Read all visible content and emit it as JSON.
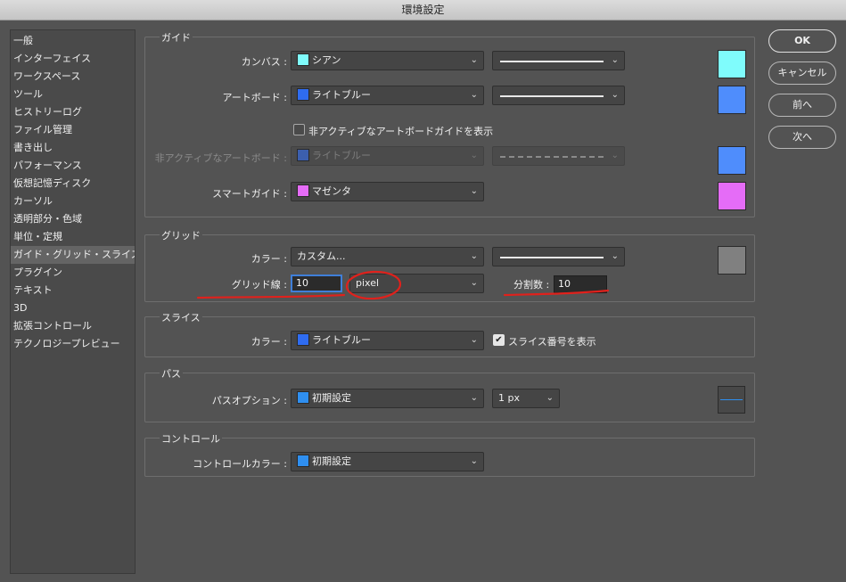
{
  "window": {
    "title": "環境設定"
  },
  "sidebar": {
    "items": [
      {
        "label": "一般"
      },
      {
        "label": "インターフェイス"
      },
      {
        "label": "ワークスペース"
      },
      {
        "label": "ツール"
      },
      {
        "label": "ヒストリーログ"
      },
      {
        "label": "ファイル管理"
      },
      {
        "label": "書き出し"
      },
      {
        "label": "パフォーマンス"
      },
      {
        "label": "仮想記憶ディスク"
      },
      {
        "label": "カーソル"
      },
      {
        "label": "透明部分・色域"
      },
      {
        "label": "単位・定規"
      },
      {
        "label": "ガイド・グリッド・スライス"
      },
      {
        "label": "プラグイン"
      },
      {
        "label": "テキスト"
      },
      {
        "label": "3D"
      },
      {
        "label": "拡張コントロール"
      },
      {
        "label": "テクノロジープレビュー"
      }
    ],
    "active_index": 12
  },
  "guides": {
    "title": "ガイド",
    "canvas": {
      "label": "カンバス :",
      "color": "シアン",
      "swatch": "#7ffcfc"
    },
    "artboard": {
      "label": "アートボード :",
      "color": "ライトブルー",
      "swatch": "#4f8dfc"
    },
    "inactive_checkbox_label": "非アクティブなアートボードガイドを表示",
    "inactive_artboard": {
      "label": "非アクティブなアートボード :",
      "color": "ライトブルー",
      "swatch": "#4f8dfc"
    },
    "smart": {
      "label": "スマートガイド :",
      "color": "マゼンタ",
      "swatch": "#e56cf7"
    }
  },
  "grid": {
    "title": "グリッド",
    "color_label": "カラー :",
    "color_value": "カスタム...",
    "swatch": "#808080",
    "gridline_label": "グリッド線 :",
    "gridline_value": "10",
    "unit_value": "pixel",
    "subdiv_label": "分割数 :",
    "subdiv_value": "10"
  },
  "slices": {
    "title": "スライス",
    "color_label": "カラー :",
    "color_value": "ライトブルー",
    "swatch": "#2f6cf0",
    "checkbox_label": "スライス番号を表示"
  },
  "paths": {
    "title": "パス",
    "option_label": "パスオプション :",
    "option_value": "初期設定",
    "swatch": "#2f8ff0",
    "width_value": "1 px"
  },
  "controls": {
    "title": "コントロール",
    "color_label": "コントロールカラー :",
    "color_value": "初期設定",
    "swatch": "#2f8ff0"
  },
  "buttons": {
    "ok": "OK",
    "cancel": "キャンセル",
    "prev": "前へ",
    "next": "次へ"
  },
  "icons": {
    "dropdown": "chevron-down-icon",
    "check": "checkmark-icon"
  },
  "annotation_color": "#e0211c"
}
